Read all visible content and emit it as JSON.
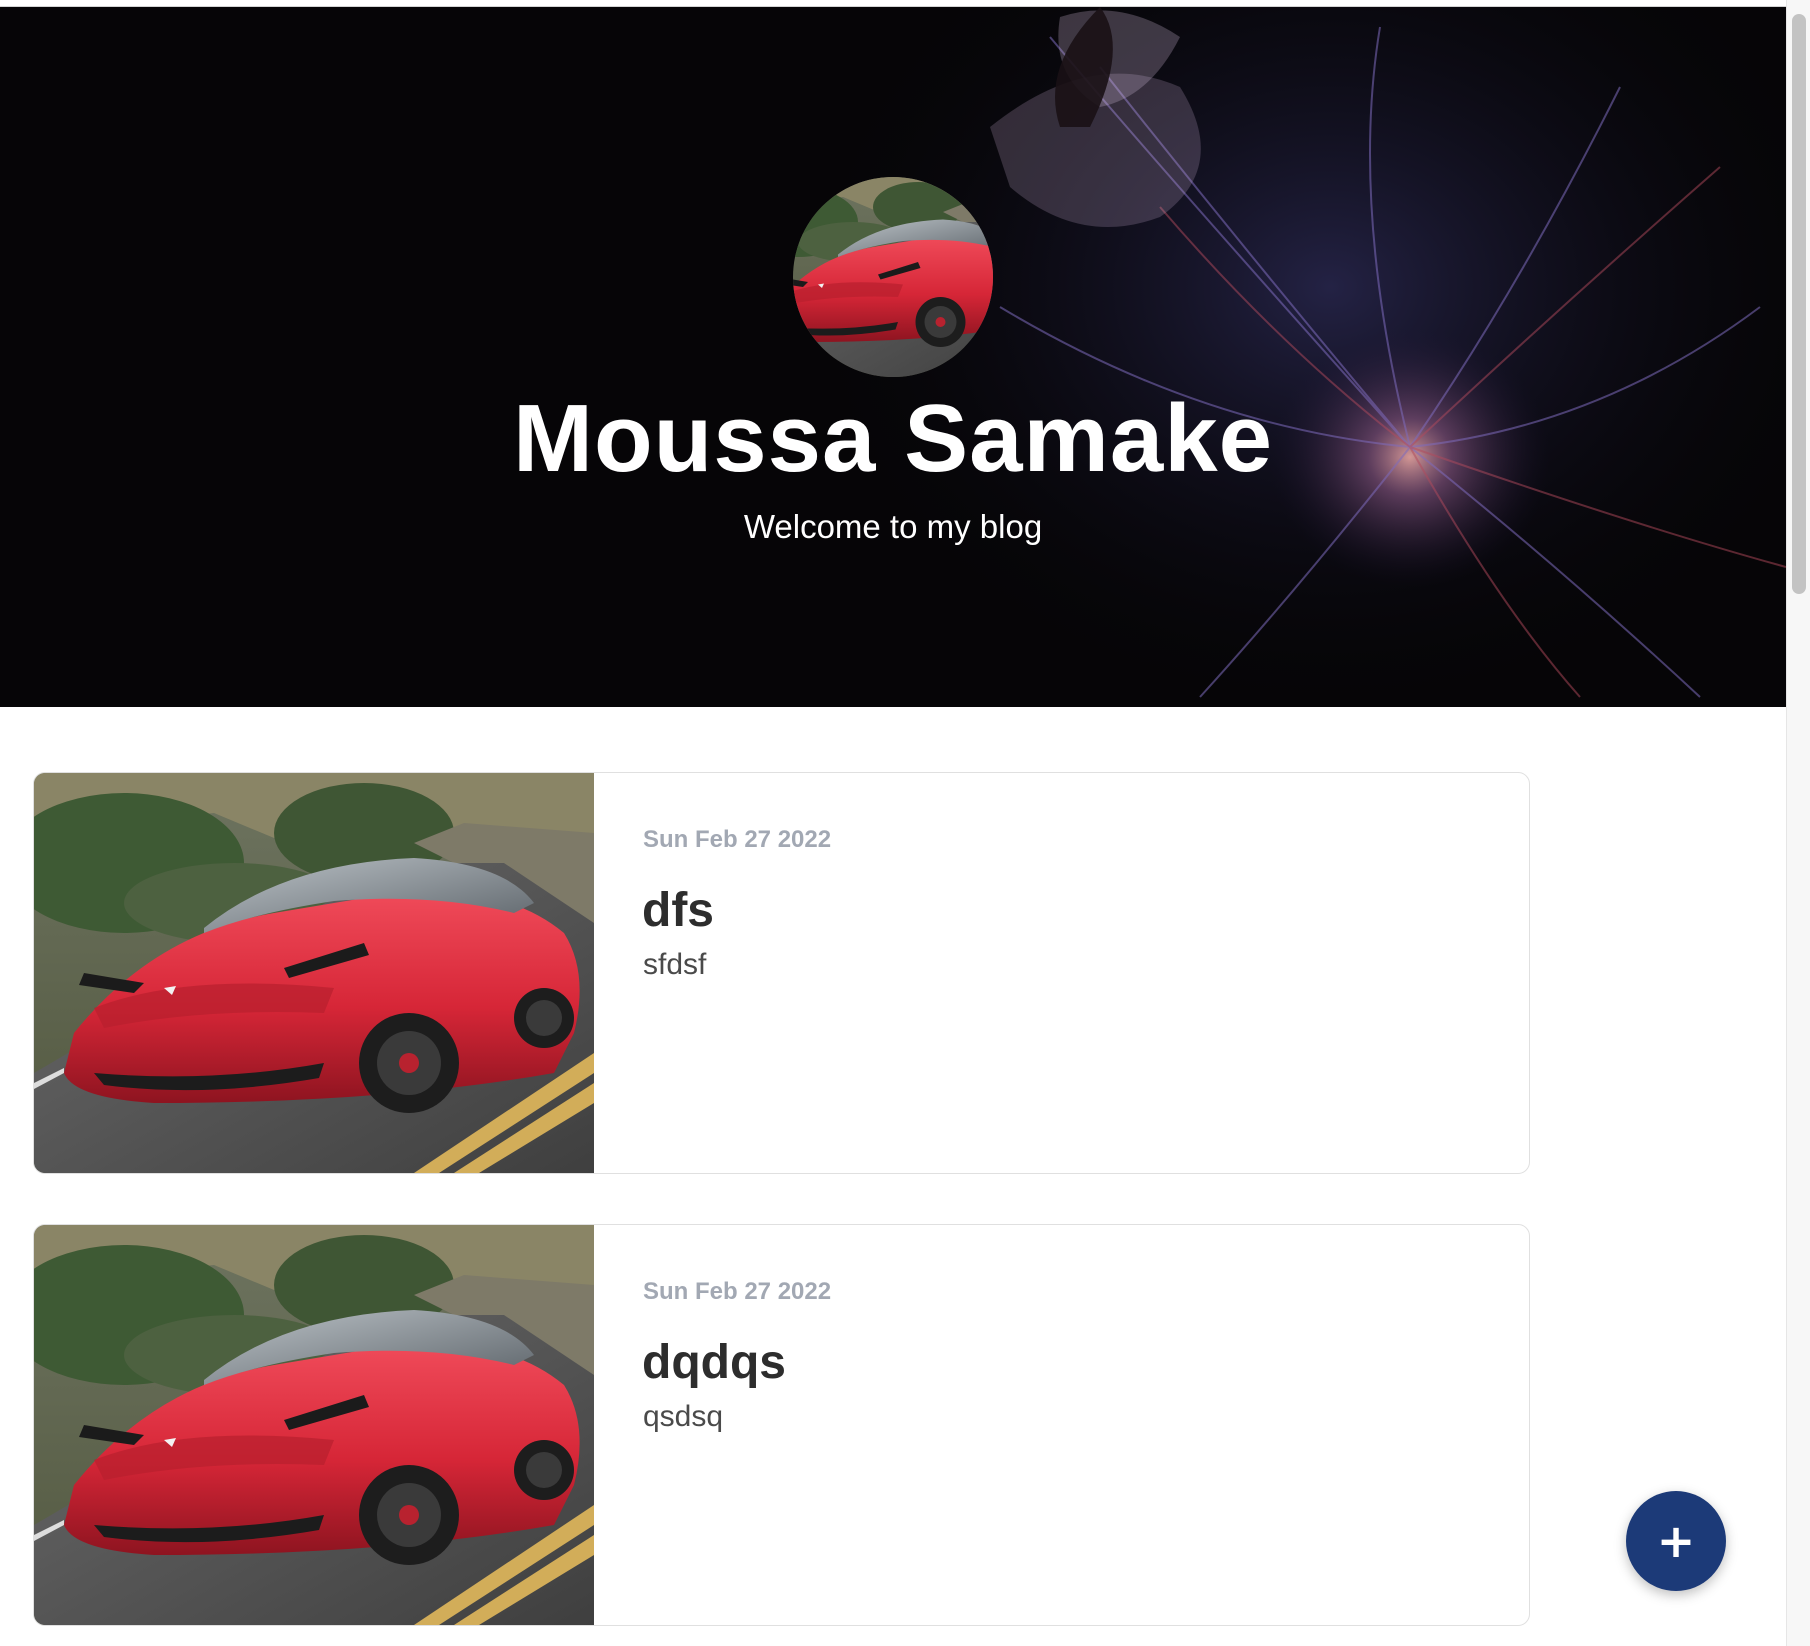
{
  "hero": {
    "title": "Moussa Samake",
    "subtitle": "Welcome to my blog"
  },
  "posts": [
    {
      "date": "Sun Feb 27 2022",
      "title": "dfs",
      "excerpt": "sfdsf",
      "image": "red-sports-car-photo"
    },
    {
      "date": "Sun Feb 27 2022",
      "title": "dqdqs",
      "excerpt": "qsdsq",
      "image": "red-sports-car-photo"
    }
  ],
  "fab": {
    "label": "+",
    "icon": "plus-icon"
  },
  "colors": {
    "hero_background": "#060507",
    "fab_background": "#1c3a78",
    "date_text": "#a2a8b3",
    "title_text": "#2d2d2d"
  }
}
